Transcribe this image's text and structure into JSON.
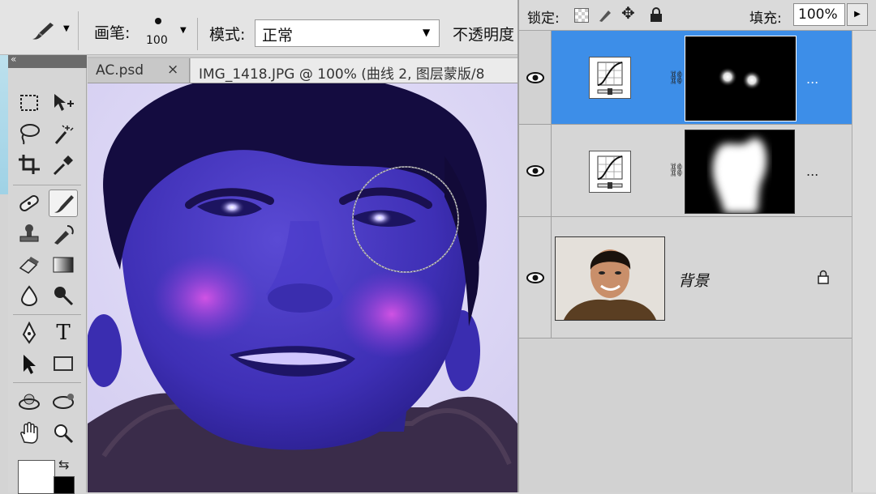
{
  "options_bar": {
    "brush_label": "画笔:",
    "brush_size": "100",
    "mode_label": "模式:",
    "mode_value": "正常",
    "opacity_label": "不透明度"
  },
  "tabs": [
    {
      "label": "AC.psd",
      "close": "×"
    },
    {
      "label": "IMG_1418.JPG @ 100% (曲线 2, 图层蒙版/8"
    }
  ],
  "lock_bar": {
    "lock_label": "锁定:",
    "fill_label": "填充:",
    "fill_value": "100%"
  },
  "layers": [
    {
      "name": "",
      "type": "curves",
      "selected": true,
      "more": "..."
    },
    {
      "name": "",
      "type": "curves",
      "selected": false,
      "more": "..."
    },
    {
      "name": "背景",
      "type": "background",
      "selected": false,
      "locked": true
    }
  ],
  "colors": {
    "selection": "#3d8ee8",
    "canvas_tint": "#3a2aa8",
    "toolbox_bg": "#d6d6d6"
  },
  "icons": {
    "tools": [
      "marquee-icon",
      "move-icon",
      "lasso-icon",
      "magic-wand-icon",
      "crop-icon",
      "eyedropper-icon",
      "healing-brush-icon",
      "brush-icon",
      "clone-stamp-icon",
      "history-brush-icon",
      "eraser-icon",
      "gradient-icon",
      "blur-icon",
      "dodge-icon",
      "pen-icon",
      "type-icon",
      "path-selection-icon",
      "rectangle-icon",
      "3d-rotate-icon",
      "3d-orbit-icon",
      "hand-icon",
      "zoom-icon"
    ]
  }
}
